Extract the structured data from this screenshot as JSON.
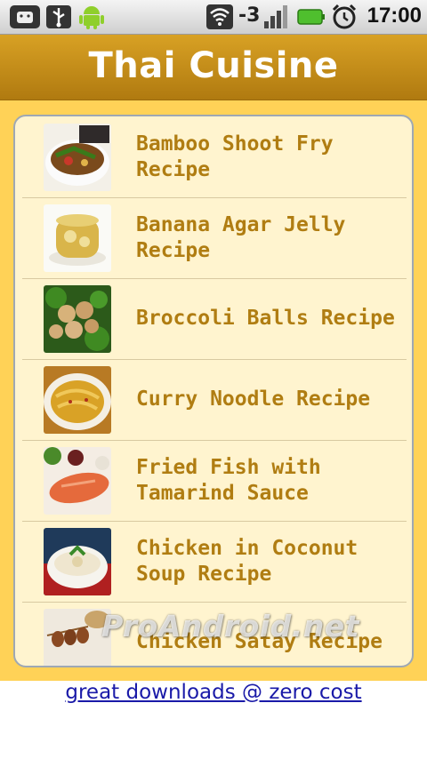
{
  "status_bar": {
    "signal_label": "-3",
    "time": "17:00",
    "icons": [
      "android-debug-icon",
      "usb-icon",
      "android-icon",
      "wifi-icon",
      "signal-icon",
      "battery-icon",
      "alarm-icon"
    ]
  },
  "header": {
    "title": "Thai Cuisine"
  },
  "recipes": [
    {
      "label": "Bamboo Shoot Fry Recipe"
    },
    {
      "label": "Banana Agar Jelly Recipe"
    },
    {
      "label": "Broccoli Balls Recipe"
    },
    {
      "label": "Curry Noodle Recipe"
    },
    {
      "label": "Fried Fish with Tamarind Sauce"
    },
    {
      "label": "Chicken in Coconut Soup Recipe"
    },
    {
      "label": "Chicken Satay Recipe"
    }
  ],
  "watermark": "ProAndroid.net",
  "footer": {
    "link_text": "great downloads @ zero cost"
  },
  "colors": {
    "title_bar": "#c28c18",
    "background": "#ffd257",
    "panel": "#fff4cf",
    "label_text": "#b07d12",
    "link": "#1a1aa8"
  }
}
